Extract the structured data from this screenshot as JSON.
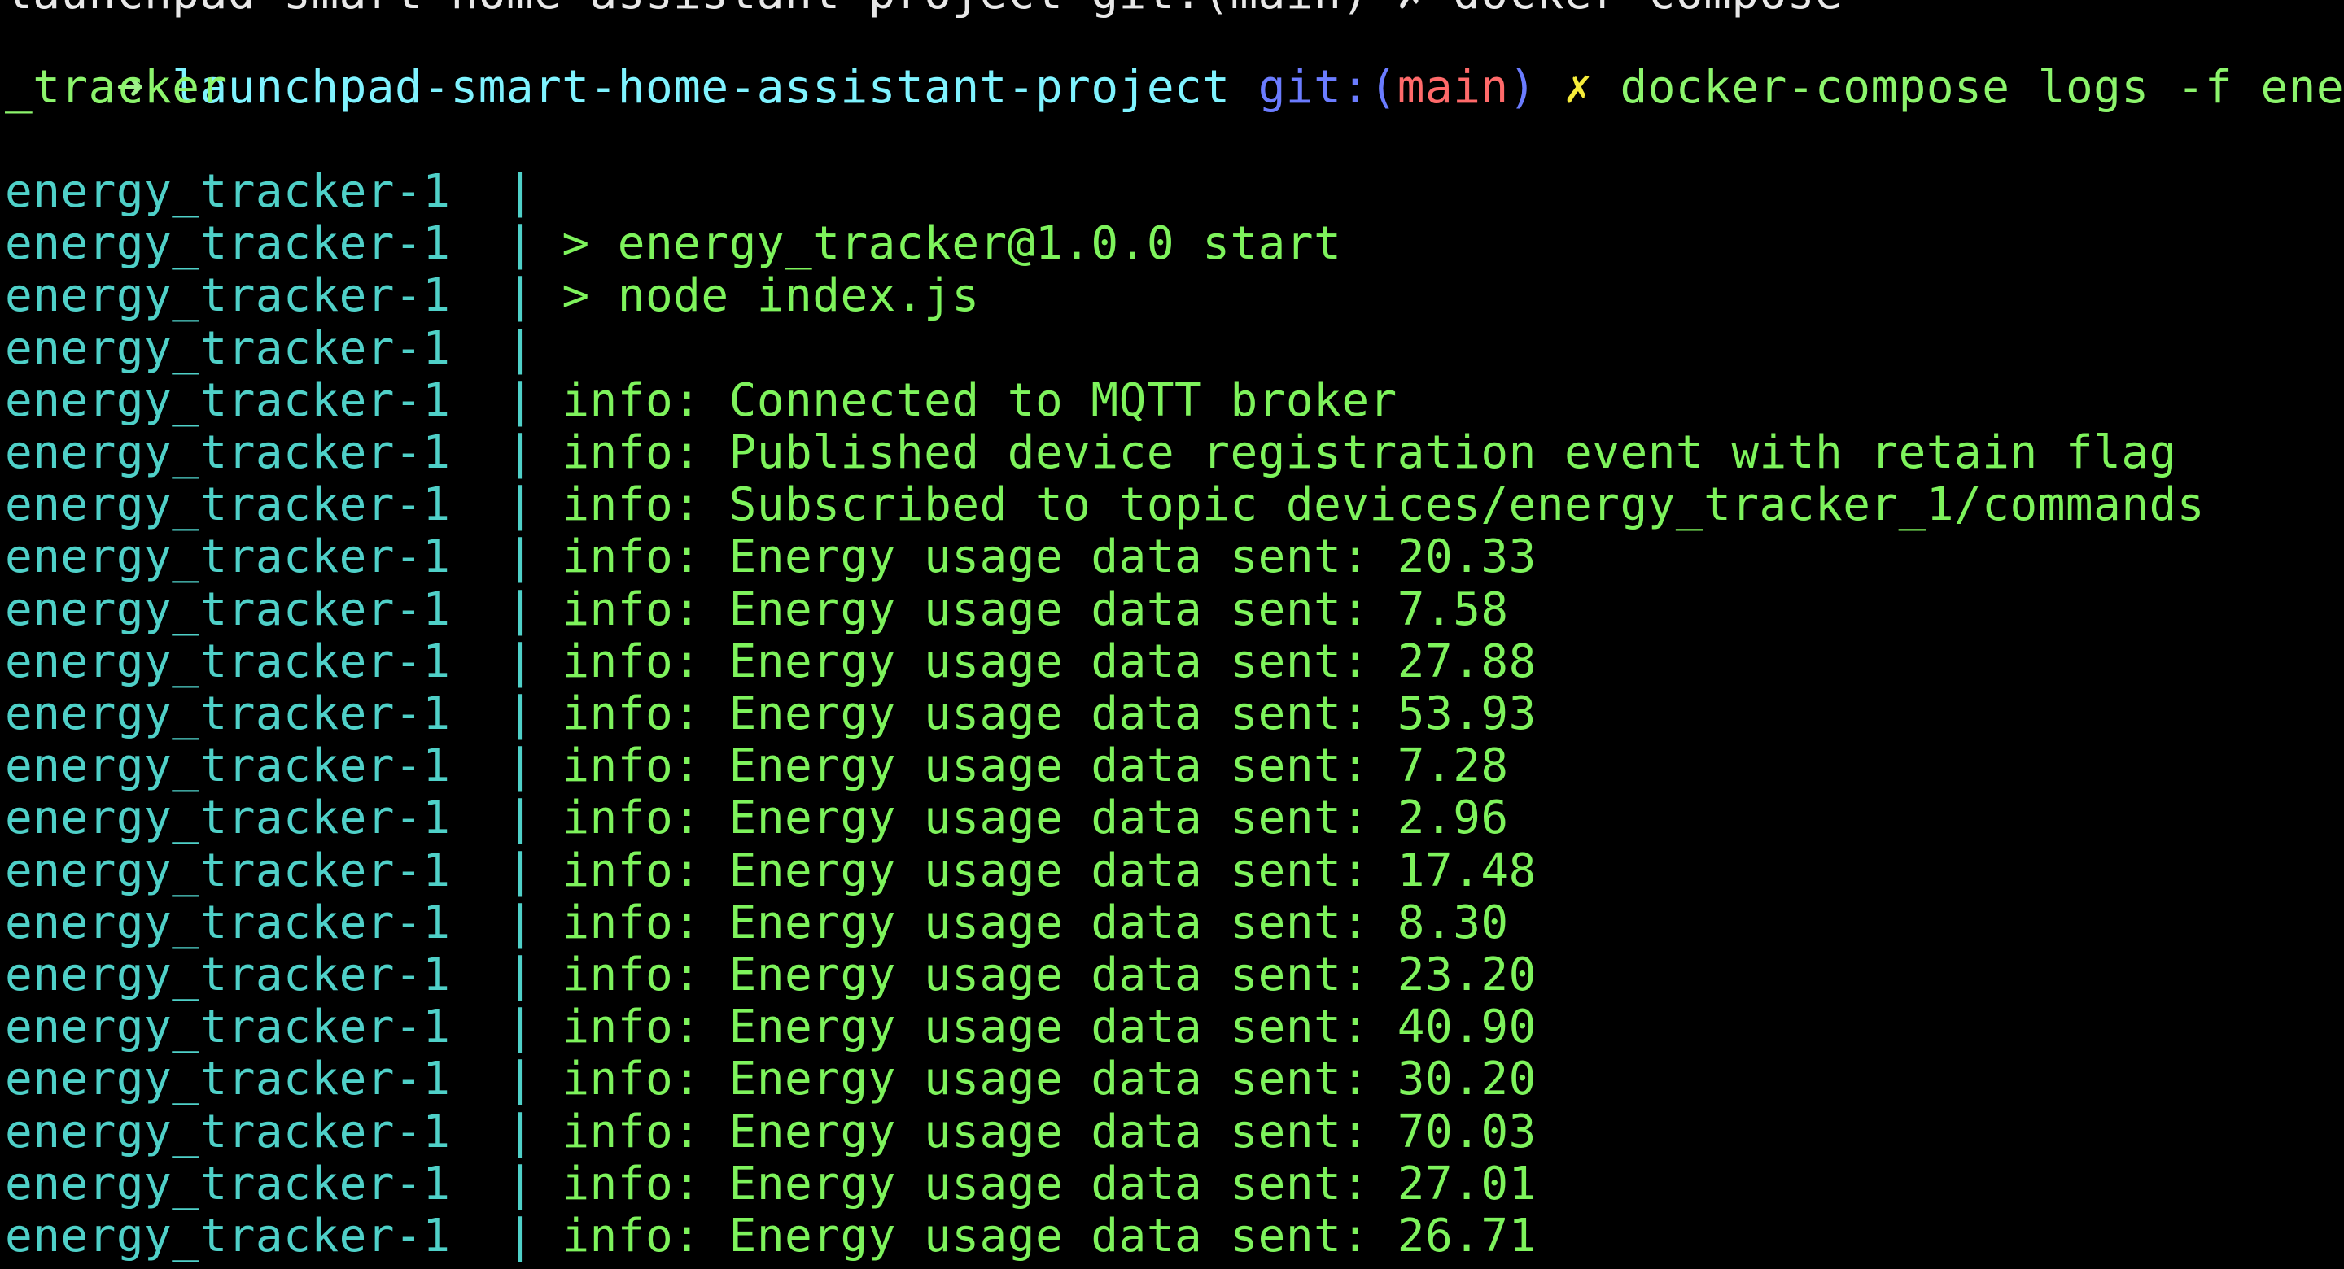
{
  "terminal": {
    "partial_top_line": "launchpad-smart-home-assistant-project git:(main) ✗ docker-compose",
    "prompt": {
      "arrow": "➜",
      "directory": "launchpad-smart-home-assistant-project",
      "git_label": "git:(",
      "branch": "main",
      "git_close": ")",
      "dirty_marker": "✗",
      "command": "docker-compose logs -f energy",
      "command_wrap": "_tracker"
    },
    "log_prefix": "energy_tracker-1  |",
    "log_lines": [
      "",
      "> energy_tracker@1.0.0 start",
      "> node index.js",
      "",
      "info: Connected to MQTT broker",
      "info: Published device registration event with retain flag",
      "info: Subscribed to topic devices/energy_tracker_1/commands",
      "info: Energy usage data sent: 20.33",
      "info: Energy usage data sent: 7.58",
      "info: Energy usage data sent: 27.88",
      "info: Energy usage data sent: 53.93",
      "info: Energy usage data sent: 7.28",
      "info: Energy usage data sent: 2.96",
      "info: Energy usage data sent: 17.48",
      "info: Energy usage data sent: 8.30",
      "info: Energy usage data sent: 23.20",
      "info: Energy usage data sent: 40.90",
      "info: Energy usage data sent: 30.20",
      "info: Energy usage data sent: 70.03",
      "info: Energy usage data sent: 27.01",
      "info: Energy usage data sent: 26.71"
    ],
    "colors": {
      "background": "#000000",
      "prompt_arrow": "#9ef08a",
      "directory": "#7ff3ff",
      "git": "#6b7cff",
      "branch": "#ff6a6a",
      "dirty": "#f5ec3a",
      "command": "#8cf46c",
      "log_prefix": "#4fd0c8",
      "log_message": "#7ef35c"
    }
  }
}
